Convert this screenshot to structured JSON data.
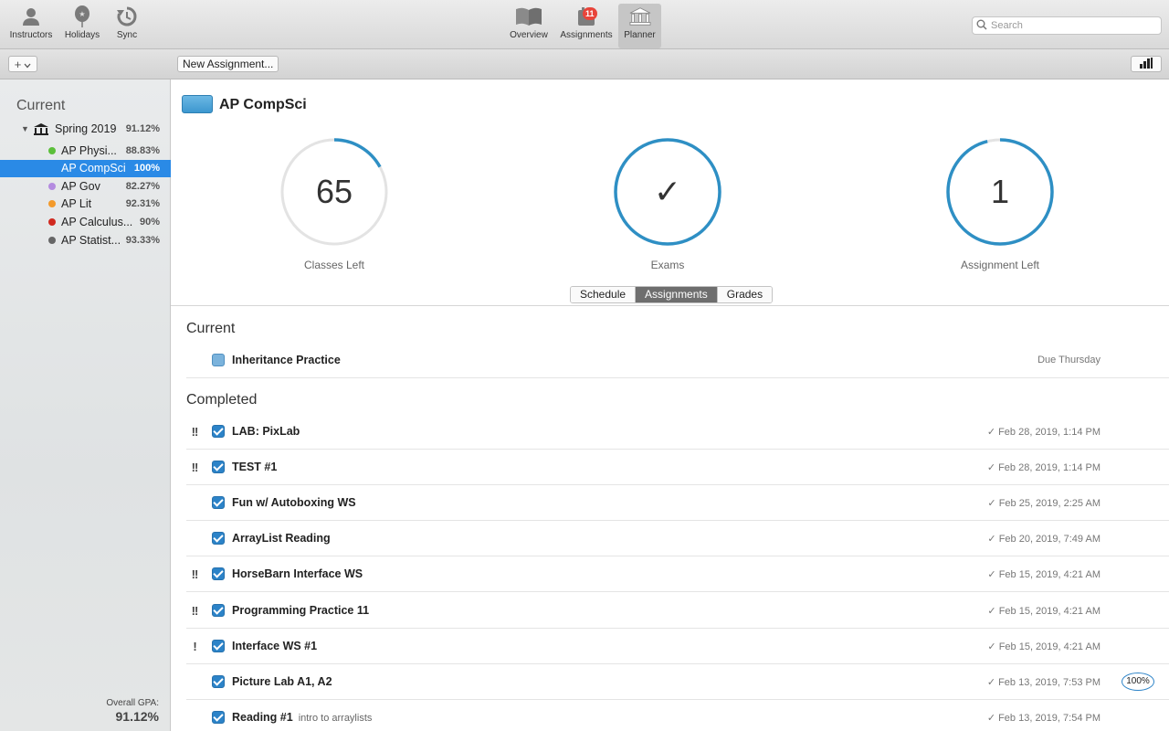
{
  "toolbar": {
    "left": [
      {
        "label": "Instructors",
        "icon": "person-icon"
      },
      {
        "label": "Holidays",
        "icon": "balloon-icon"
      },
      {
        "label": "Sync",
        "icon": "sync-icon"
      }
    ],
    "center": [
      {
        "label": "Overview",
        "icon": "book-icon"
      },
      {
        "label": "Assignments",
        "icon": "assignments-icon",
        "badge": "11"
      },
      {
        "label": "Planner",
        "icon": "building-icon",
        "active": true
      }
    ],
    "search_placeholder": "Search"
  },
  "subbar": {
    "plus_label": "+",
    "new_assignment_label": "New Assignment..."
  },
  "sidebar": {
    "section_title": "Current",
    "term": {
      "name": "Spring 2019",
      "pct": "91.12%"
    },
    "courses": [
      {
        "name": "AP Physi...",
        "pct": "88.83%",
        "color": "#5bbf3a"
      },
      {
        "name": "AP CompSci",
        "pct": "100%",
        "color": "#2a8ae6",
        "selected": true
      },
      {
        "name": "AP Gov",
        "pct": "82.27%",
        "color": "#b48be0"
      },
      {
        "name": "AP Lit",
        "pct": "92.31%",
        "color": "#f39a2b"
      },
      {
        "name": "AP Calculus...",
        "pct": "90%",
        "color": "#d0291f"
      },
      {
        "name": "AP Statist...",
        "pct": "93.33%",
        "color": "#666666"
      }
    ],
    "gpa_label": "Overall GPA:",
    "gpa_value": "91.12%"
  },
  "main": {
    "course_title": "AP CompSci",
    "accent": "#2e8fc4",
    "rings": [
      {
        "value": "65",
        "label": "Classes Left",
        "progress": 0.17
      },
      {
        "value": "✓",
        "label": "Exams",
        "progress": 1.0
      },
      {
        "value": "1",
        "label": "Assignment Left",
        "progress": 0.96
      }
    ],
    "tabs": [
      "Schedule",
      "Assignments",
      "Grades"
    ],
    "active_tab": "Assignments",
    "current_header": "Current",
    "current": [
      {
        "name": "Inheritance Practice",
        "due": "Due Thursday"
      }
    ],
    "completed_header": "Completed",
    "completed": [
      {
        "prio": "!!",
        "name": "LAB: PixLab",
        "date": "✓ Feb 28, 2019, 1:14 PM"
      },
      {
        "prio": "!!",
        "name": "TEST #1",
        "date": "✓ Feb 28, 2019, 1:14 PM"
      },
      {
        "prio": "",
        "name": "Fun w/ Autoboxing WS",
        "date": "✓ Feb 25, 2019, 2:25 AM"
      },
      {
        "prio": "",
        "name": "ArrayList Reading",
        "date": "✓ Feb 20, 2019, 7:49 AM"
      },
      {
        "prio": "!!",
        "name": "HorseBarn Interface WS",
        "date": "✓ Feb 15, 2019, 4:21 AM"
      },
      {
        "prio": "!!",
        "name": "Programming Practice 11",
        "date": "✓ Feb 15, 2019, 4:21 AM"
      },
      {
        "prio": "!",
        "name": "Interface WS #1",
        "date": "✓ Feb 15, 2019, 4:21 AM"
      },
      {
        "prio": "",
        "name": "Picture Lab A1, A2",
        "date": "✓ Feb 13, 2019, 7:53 PM",
        "grade": "100%"
      },
      {
        "prio": "",
        "name": "Reading #1",
        "note": "intro to arraylists",
        "date": "✓ Feb 13, 2019, 7:54 PM"
      }
    ]
  }
}
